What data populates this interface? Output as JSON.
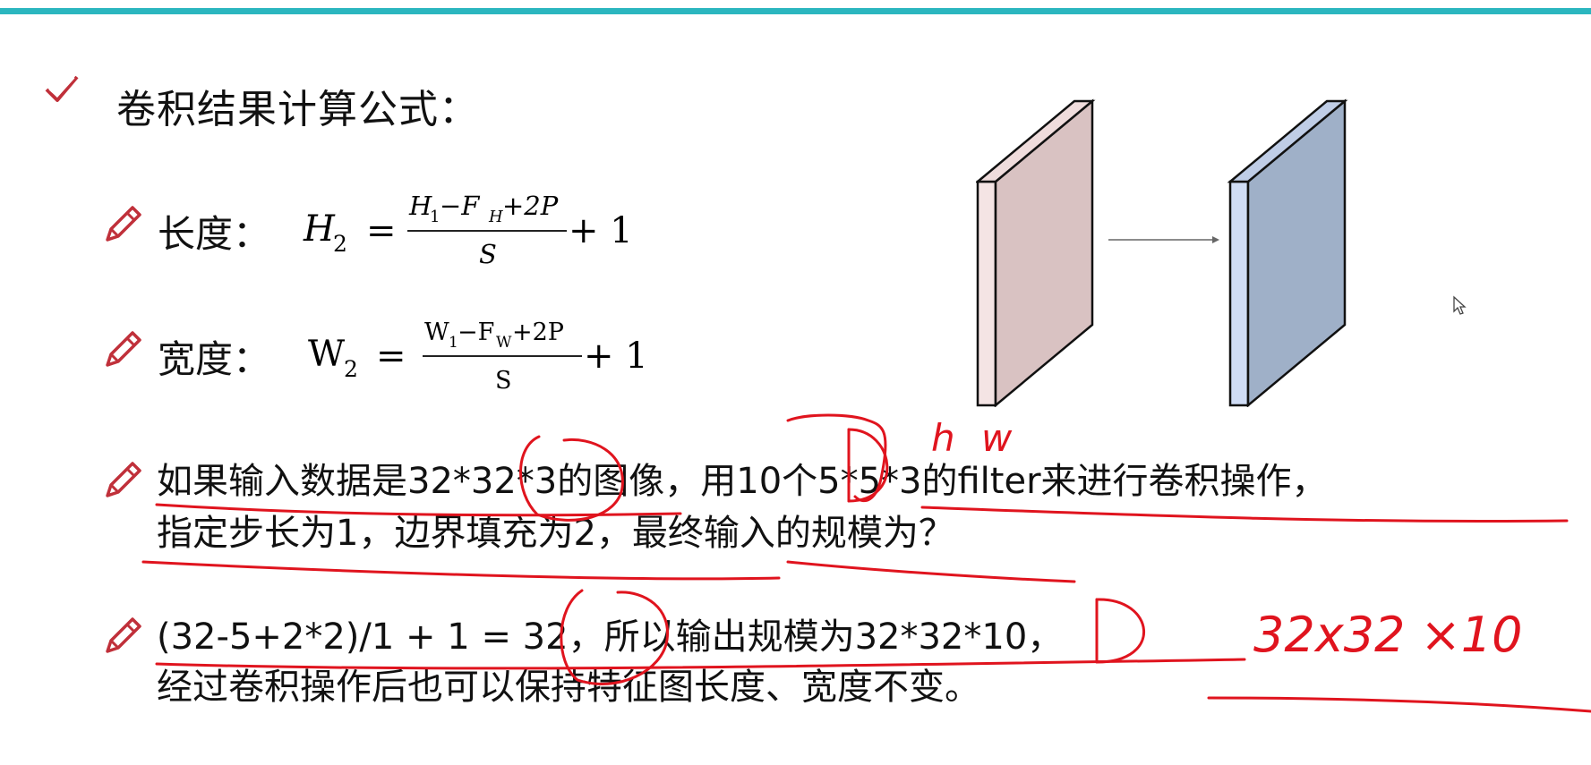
{
  "slide": {
    "heading": "卷积结果计算公式：",
    "length_label": "长度：",
    "width_label": "宽度：",
    "question_line1": "如果输入数据是32*32*3的图像，用10个5*5*3的filter来进行卷积操作，",
    "question_line2": "指定步长为1，边界填充为2，最终输入的规模为？",
    "answer_line1": "(32-5+2*2)/1 + 1 = 32，所以输出规模为32*32*10，",
    "answer_line2": "经过卷积操作后也可以保持特征图长度、宽度不变。"
  },
  "formula_h": {
    "lhs": "H",
    "lhs_sub": "2",
    "num_a": "H",
    "num_a_sub": "1",
    "num_b": " −F",
    "num_b_sub": "H",
    "num_c": "+2P",
    "den": "S",
    "tail": "+ 1"
  },
  "formula_w": {
    "lhs": "W",
    "lhs_sub": "2",
    "num_a": "W",
    "num_a_sub": "1",
    "num_b": "−F",
    "num_b_sub": "W",
    "num_c": "+2P",
    "den": "S",
    "tail": "+ 1"
  },
  "handwriting": {
    "hw": "h w",
    "result": "32x32 ×10"
  },
  "colors": {
    "accent_bar": "#2bb6bf",
    "icon_red": "#c0303a",
    "ink_red": "#e0141e",
    "slab1_front": "#d9c2c2",
    "slab1_side": "#f4e4e4",
    "slab2_front": "#9fb0c8",
    "slab2_side": "#cfdcf5"
  },
  "icons": [
    "check-icon",
    "pencil-icon",
    "arrow-icon",
    "mouse-cursor-icon"
  ]
}
